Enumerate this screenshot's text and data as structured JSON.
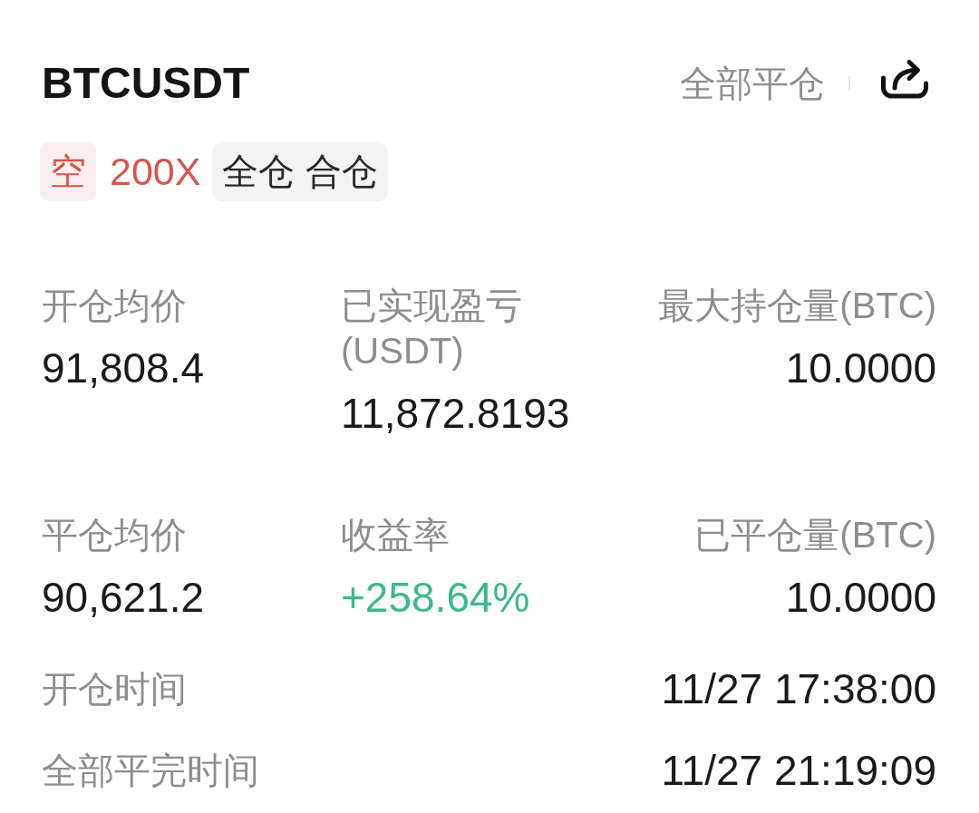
{
  "header": {
    "symbol": "BTCUSDT",
    "close_all": "全部平仓"
  },
  "tags": [
    {
      "kind": "side",
      "text": "空"
    },
    {
      "kind": "leverage",
      "text": "200X"
    },
    {
      "kind": "mode",
      "text": "全仓 合仓"
    }
  ],
  "stats": [
    {
      "label": "开仓均价",
      "value": "91,808.4",
      "kind": "plain"
    },
    {
      "label": "已实现盈亏(USDT)",
      "value": "11,872.8193",
      "kind": "plain"
    },
    {
      "label": "最大持仓量(BTC)",
      "value": "10.0000",
      "kind": "plain"
    },
    {
      "label": "平仓均价",
      "value": "90,621.2",
      "kind": "plain"
    },
    {
      "label": "收益率",
      "value": "+258.64%",
      "kind": "gain"
    },
    {
      "label": "已平仓量(BTC)",
      "value": "10.0000",
      "kind": "plain"
    }
  ],
  "times": [
    {
      "label": "开仓时间",
      "value": "11/27 17:38:00"
    },
    {
      "label": "全部平完时间",
      "value": "11/27 21:19:09"
    }
  ]
}
